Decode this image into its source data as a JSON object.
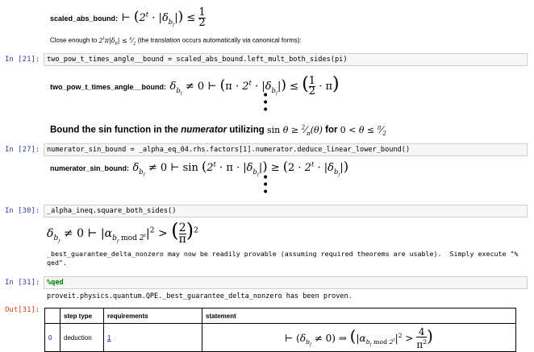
{
  "cells": {
    "scaled_label": "scaled_abs_bound:",
    "close_enough_text": "Close enough to",
    "close_enough_tail": "(the translation occurs automatically via canonical forms):",
    "c21_prompt": "In [21]:",
    "c21_code": "two_pow_t_times_angle__bound = scaled_abs_bound.left_mult_both_sides(pi)",
    "two_pow_label": "two_pow_t_times_angle__bound:",
    "heading_pre": "Bound the sin function in the",
    "heading_em": "numerator",
    "heading_mid": "utilizing",
    "heading_for": "for",
    "c27_prompt": "In [27]:",
    "c27_code": "numerator_sin_bound = _alpha_eq_04.rhs.factors[1].numerator.deduce_linear_lower_bound()",
    "num_sin_label": "numerator_sin_bound:",
    "c30_prompt": "In [30]:",
    "c30_code": "_alpha_ineq.square_both_sides()",
    "note_line1": "_best_guarantee_delta_nonzero may now be readily provable (assuming required theorems are usable).  Simply execute \"%",
    "note_line2": "qed\".",
    "c31_prompt": "In [31]:",
    "c31_code": "%qed",
    "proven_text": "proveit.physics.quantum.QPE._best_guarantee_delta_nonzero has been proven.",
    "out31_prompt": "Out[31]:"
  },
  "proof_table": {
    "headers": [
      "",
      "step type",
      "requirements",
      "statement"
    ],
    "rows": [
      {
        "index": "0",
        "step_type": "deduction",
        "requirement": "1"
      }
    ]
  },
  "colors": {
    "in_prompt": "#303f9f",
    "out_prompt": "#d84315",
    "link": "#1a0dab",
    "code_bg": "#f7f7f7"
  }
}
